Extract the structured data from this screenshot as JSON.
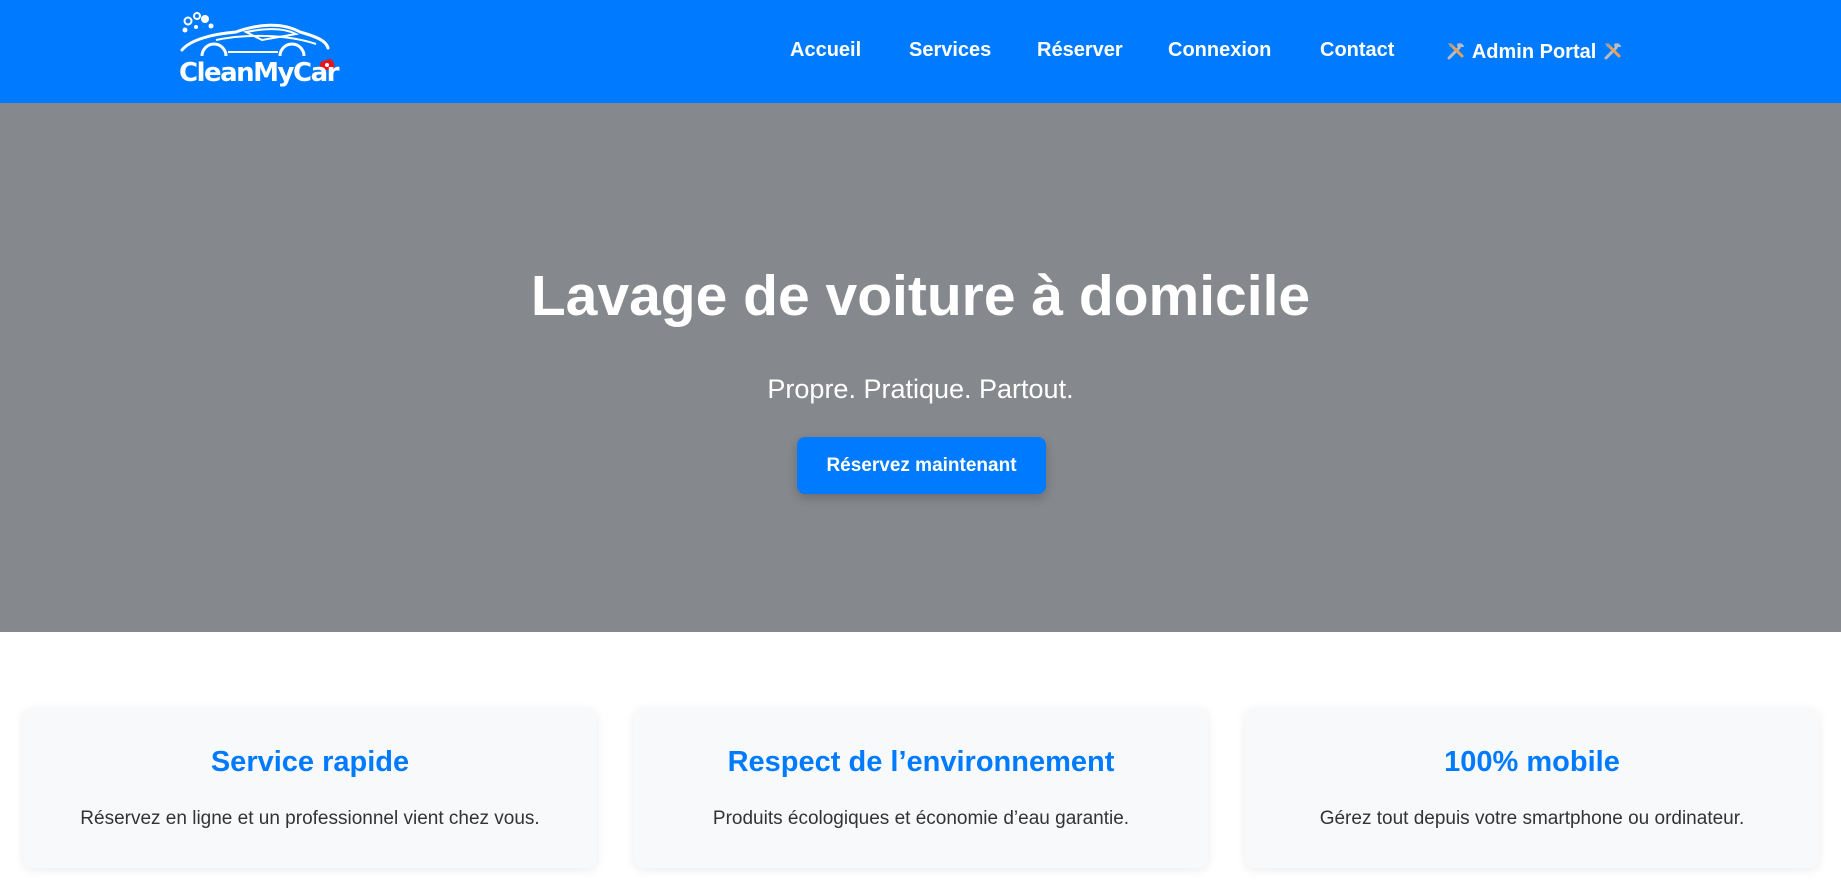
{
  "colors": {
    "brand": "#007bff",
    "hero_overlay": "#85888d",
    "card_bg": "#f8f9fa",
    "body_text": "#333333"
  },
  "header": {
    "logo_text": "CleanMyCar",
    "nav": [
      {
        "label": "Accueil"
      },
      {
        "label": "Services"
      },
      {
        "label": "Réserver"
      },
      {
        "label": "Connexion"
      },
      {
        "label": "Contact"
      },
      {
        "label": "Admin Portal",
        "icon": "tools-icon"
      }
    ]
  },
  "hero": {
    "title": "Lavage de voiture à domicile",
    "subtitle": "Propre. Pratique. Partout.",
    "cta_label": "Réservez maintenant"
  },
  "features": [
    {
      "title": "Service rapide",
      "text": "Réservez en ligne et un professionnel vient chez vous."
    },
    {
      "title": "Respect de l’environnement",
      "text": "Produits écologiques et économie d’eau garantie."
    },
    {
      "title": "100% mobile",
      "text": "Gérez tout depuis votre smartphone ou ordinateur."
    }
  ]
}
